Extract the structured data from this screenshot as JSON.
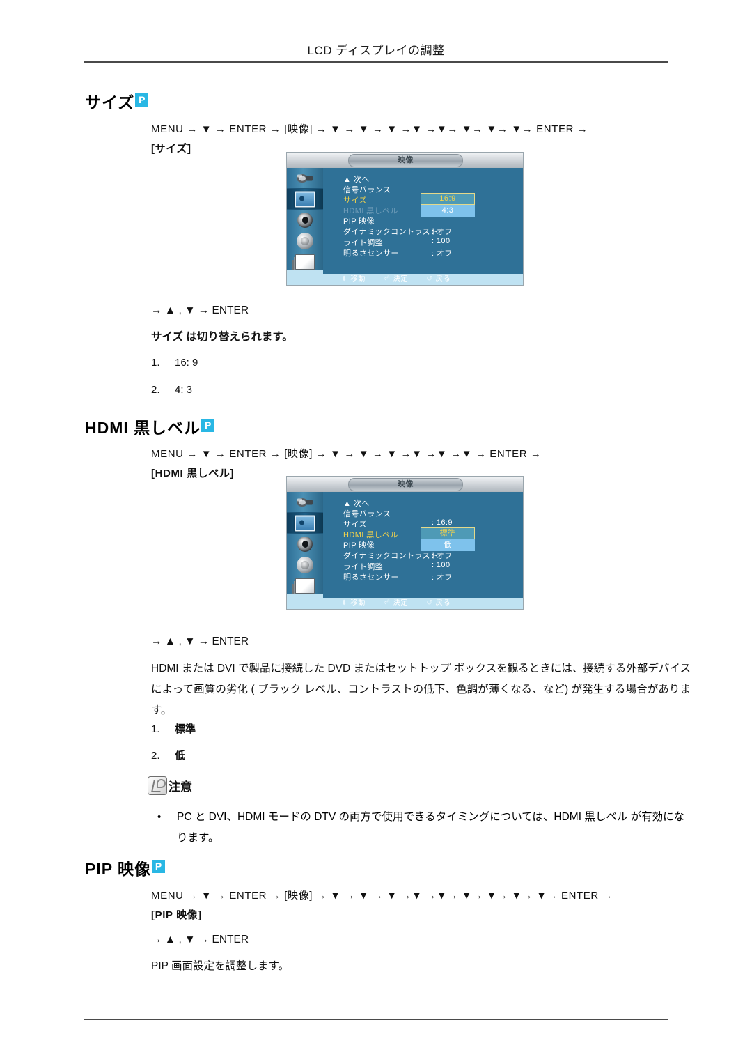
{
  "header": {
    "title": "LCD ディスプレイの調整"
  },
  "sections": [
    {
      "heading": "サイズ",
      "badge": "P",
      "nav_line": "MENU → ▼ → ENTER → [映像] → ▼ → ▼ → ▼ →▼ →▼→ ▼→ ▼→ ▼→ ENTER →",
      "nav_target": "[サイズ]",
      "nav_after": "→ ▲ , ▼ → ENTER",
      "description": "サイズ は切り替えられます。",
      "options": [
        {
          "num": "1.",
          "label": "16: 9"
        },
        {
          "num": "2.",
          "label": "4: 3"
        }
      ]
    },
    {
      "heading": "HDMI 黒しベル",
      "badge": "P",
      "nav_line": "MENU → ▼ → ENTER → [映像] → ▼ → ▼ → ▼ →▼ →▼ →▼ → ENTER →",
      "nav_target": "[HDMI 黒しベル]",
      "nav_after": "→ ▲ , ▼ → ENTER",
      "description": "HDMI または DVI で製品に接続した DVD またはセットトップ ボックスを観るときには、接続する外部デバイスによって画質の劣化 ( ブラック レベル、コントラストの低下、色調が薄くなる、など)  が発生する場合があります。",
      "options": [
        {
          "num": "1.",
          "label": "標準"
        },
        {
          "num": "2.",
          "label": "低"
        }
      ],
      "note": {
        "title": "注意",
        "icon": "note-pencil-icon",
        "bullets": [
          "PC と DVI、HDMI モードの DTV の両方で使用できるタイミングについては、HDMI 黒しベル が有効になります。"
        ]
      }
    },
    {
      "heading": "PIP 映像",
      "badge": "P",
      "nav_line": "MENU → ▼ → ENTER → [映像] → ▼ → ▼ → ▼ →▼ →▼→ ▼→ ▼→ ▼→ ▼→ ENTER →",
      "nav_target": "[PIP 映像]",
      "nav_after": "→ ▲ , ▼ → ENTER",
      "description": "PIP 画面設定を調整します。"
    }
  ],
  "osd": {
    "title": "映像",
    "sidebar_icons": [
      "input-plug-icon",
      "picture-icon",
      "sound-speaker-icon",
      "setup-gear-icon",
      "multi-control-pages-icon"
    ],
    "hints": [
      {
        "glyph": "⬍",
        "label": "移動"
      },
      {
        "glyph": "⏎",
        "label": "決定"
      },
      {
        "glyph": "↺",
        "label": "戻る"
      }
    ],
    "menu_a": {
      "rows": [
        {
          "label": "▲ 次へ",
          "value": "",
          "state": "normal"
        },
        {
          "label": "信号バランス",
          "value": "",
          "state": "normal"
        },
        {
          "label": "サイズ",
          "value": ":",
          "state": "highlight"
        },
        {
          "label": "HDMI 黒しベル",
          "value": ":",
          "state": "dim"
        },
        {
          "label": "PIP 映像",
          "value": "",
          "state": "normal"
        },
        {
          "label": "ダイナミックコントラスト",
          "value": ": オフ",
          "state": "normal"
        },
        {
          "label": "ライト調整",
          "value": ": 100",
          "state": "normal"
        },
        {
          "label": "明るさセンサー",
          "value": ": オフ",
          "state": "normal"
        }
      ],
      "dropdown": {
        "options": [
          "16:9",
          "4:3"
        ],
        "selected": "16:9"
      }
    },
    "menu_b": {
      "rows": [
        {
          "label": "▲ 次へ",
          "value": "",
          "state": "normal"
        },
        {
          "label": "信号バランス",
          "value": "",
          "state": "normal"
        },
        {
          "label": "サイズ",
          "value": ": 16:9",
          "state": "normal"
        },
        {
          "label": "HDMI 黒しベル",
          "value": ":",
          "state": "highlight"
        },
        {
          "label": "PIP 映像",
          "value": "",
          "state": "normal"
        },
        {
          "label": "ダイナミックコントラスト",
          "value": ": オフ",
          "state": "normal"
        },
        {
          "label": "ライト調整",
          "value": ": 100",
          "state": "normal"
        },
        {
          "label": "明るさセンサー",
          "value": ": オフ",
          "state": "normal"
        }
      ],
      "dropdown": {
        "options": [
          "標準",
          "低"
        ],
        "selected": "標準"
      }
    }
  }
}
